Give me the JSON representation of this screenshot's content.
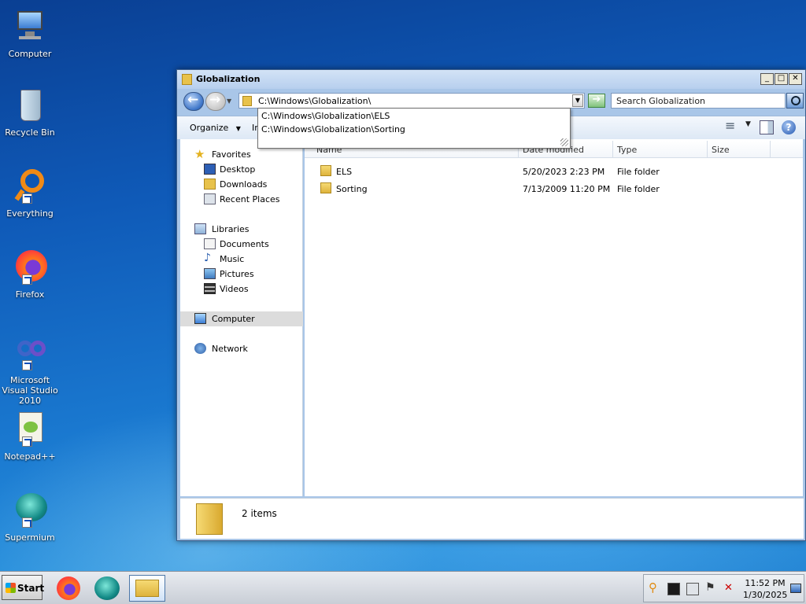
{
  "desktop": {
    "icons": [
      {
        "label": "Computer"
      },
      {
        "label": "Recycle Bin"
      },
      {
        "label": "Everything"
      },
      {
        "label": "Firefox"
      },
      {
        "label": "Microsoft Visual Studio 2010"
      },
      {
        "label": "Notepad++"
      },
      {
        "label": "Supermium"
      }
    ]
  },
  "window": {
    "title": "Globalization",
    "buttons": {
      "minimize": "_",
      "maximize": "□",
      "close": "✕"
    },
    "address": "C:\\Windows\\Globalization\\",
    "search_placeholder": "Search Globalization",
    "autocomplete": [
      "C:\\Windows\\Globalization\\ELS",
      "C:\\Windows\\Globalization\\Sorting"
    ],
    "commands": {
      "organize": "Organize",
      "include_partial": "In"
    },
    "nav": {
      "favorites": "Favorites",
      "desktop": "Desktop",
      "downloads": "Downloads",
      "recent": "Recent Places",
      "libraries": "Libraries",
      "documents": "Documents",
      "music": "Music",
      "pictures": "Pictures",
      "videos": "Videos",
      "computer": "Computer",
      "network": "Network"
    },
    "columns": {
      "name": "Name",
      "date": "Date modified",
      "type": "Type",
      "size": "Size"
    },
    "rows": [
      {
        "name": "ELS",
        "date": "5/20/2023 2:23 PM",
        "type": "File folder"
      },
      {
        "name": "Sorting",
        "date": "7/13/2009 11:20 PM",
        "type": "File folder"
      }
    ],
    "details": {
      "count": "2 items"
    }
  },
  "taskbar": {
    "start": "Start",
    "apps": [
      "firefox-icon",
      "supermium-icon",
      "explorer-icon"
    ],
    "time": "11:52 PM",
    "date": "1/30/2025"
  },
  "colors": {
    "accent": "#1f5fb8",
    "title_bg": "#c6daf3",
    "selection": "#dcdcdc"
  }
}
